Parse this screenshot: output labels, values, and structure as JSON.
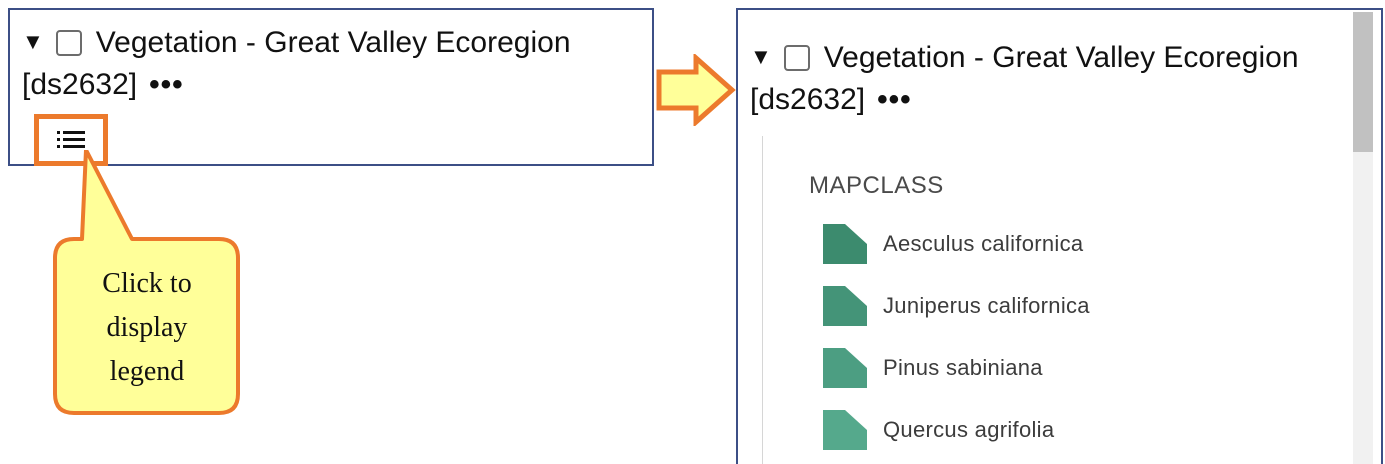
{
  "layer": {
    "expand_icon": "triangle-down-icon",
    "line1": "Vegetation - Great Valley Ecoregion",
    "line2": "[ds2632]",
    "options": "•••"
  },
  "callout": {
    "line1": "Click to",
    "line2": "display",
    "line3": "legend"
  },
  "legend": {
    "heading": "MAPCLASS",
    "items": [
      {
        "label": "Aesculus californica",
        "color": "#3c8b6e"
      },
      {
        "label": "Juniperus californica",
        "color": "#449478"
      },
      {
        "label": "Pinus sabiniana",
        "color": "#4c9e82"
      },
      {
        "label": "Quercus agrifolia",
        "color": "#55a98c"
      }
    ]
  },
  "colors": {
    "panel_border": "#3c4f86",
    "highlight_orange": "#ec7a2c",
    "callout_fill": "#ffff99"
  }
}
